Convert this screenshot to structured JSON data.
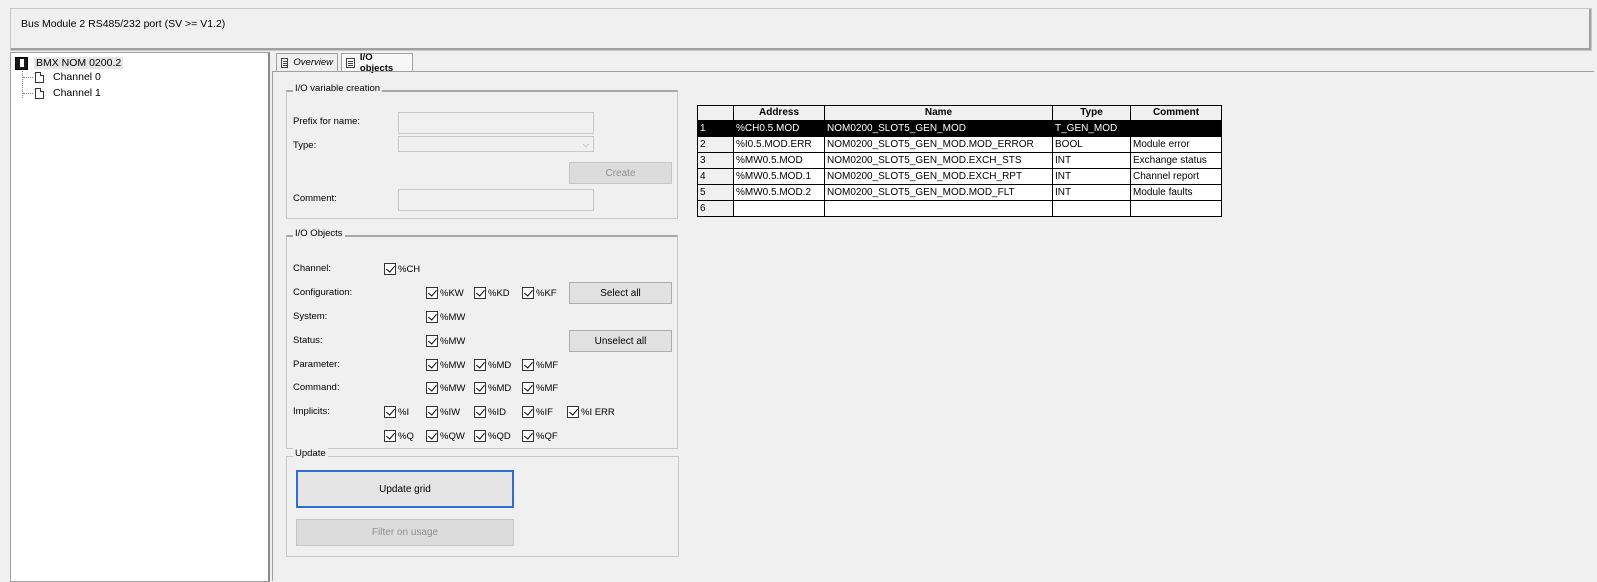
{
  "window": {
    "title": "Bus Module 2 RS485/232 port (SV >= V1.2)"
  },
  "tree": {
    "root": "BMX NOM 0200.2",
    "children": [
      "Channel 0",
      "Channel 1"
    ]
  },
  "tabs": [
    {
      "label": "Overview",
      "active": false
    },
    {
      "label": "I/O objects",
      "active": true
    }
  ],
  "var_creation": {
    "title": "I/O variable creation",
    "prefix_label": "Prefix for name:",
    "prefix_value": "",
    "type_label": "Type:",
    "type_value": "",
    "create_label": "Create",
    "comment_label": "Comment:",
    "comment_value": ""
  },
  "io_objects": {
    "title": "I/O Objects",
    "channel_label": "Channel:",
    "configuration_label": "Configuration:",
    "system_label": "System:",
    "status_label": "Status:",
    "parameter_label": "Parameter:",
    "command_label": "Command:",
    "implicits_label": "Implicits:",
    "channel": [
      "%CH"
    ],
    "configuration": [
      "%KW",
      "%KD",
      "%KF"
    ],
    "system": [
      "%MW"
    ],
    "status": [
      "%MW"
    ],
    "parameter": [
      "%MW",
      "%MD",
      "%MF"
    ],
    "command": [
      "%MW",
      "%MD",
      "%MF"
    ],
    "implicits_row1": [
      "%I",
      "%IW",
      "%ID",
      "%IF",
      "%I ERR"
    ],
    "implicits_row2": [
      "%Q",
      "%QW",
      "%QD",
      "%QF"
    ],
    "select_all_label": "Select all",
    "unselect_all_label": "Unselect all"
  },
  "update": {
    "title": "Update",
    "update_grid_label": "Update grid",
    "filter_label": "Filter on usage"
  },
  "grid": {
    "columns": [
      "Address",
      "Name",
      "Type",
      "Comment"
    ],
    "rows": [
      {
        "num": "1",
        "address": "%CH0.5.MOD",
        "name": "NOM0200_SLOT5_GEN_MOD",
        "type": "T_GEN_MOD",
        "comment": "",
        "selected": true
      },
      {
        "num": "2",
        "address": "%I0.5.MOD.ERR",
        "name": "NOM0200_SLOT5_GEN_MOD.MOD_ERROR",
        "type": "BOOL",
        "comment": "Module error"
      },
      {
        "num": "3",
        "address": "%MW0.5.MOD",
        "name": "NOM0200_SLOT5_GEN_MOD.EXCH_STS",
        "type": "INT",
        "comment": "Exchange status"
      },
      {
        "num": "4",
        "address": "%MW0.5.MOD.1",
        "name": "NOM0200_SLOT5_GEN_MOD.EXCH_RPT",
        "type": "INT",
        "comment": "Channel report"
      },
      {
        "num": "5",
        "address": "%MW0.5.MOD.2",
        "name": "NOM0200_SLOT5_GEN_MOD.MOD_FLT",
        "type": "INT",
        "comment": "Module faults"
      },
      {
        "num": "6",
        "address": "",
        "name": "",
        "type": "",
        "comment": ""
      }
    ]
  },
  "colors": {
    "selection": "#000000",
    "focus_border": "#2c6fd1"
  }
}
